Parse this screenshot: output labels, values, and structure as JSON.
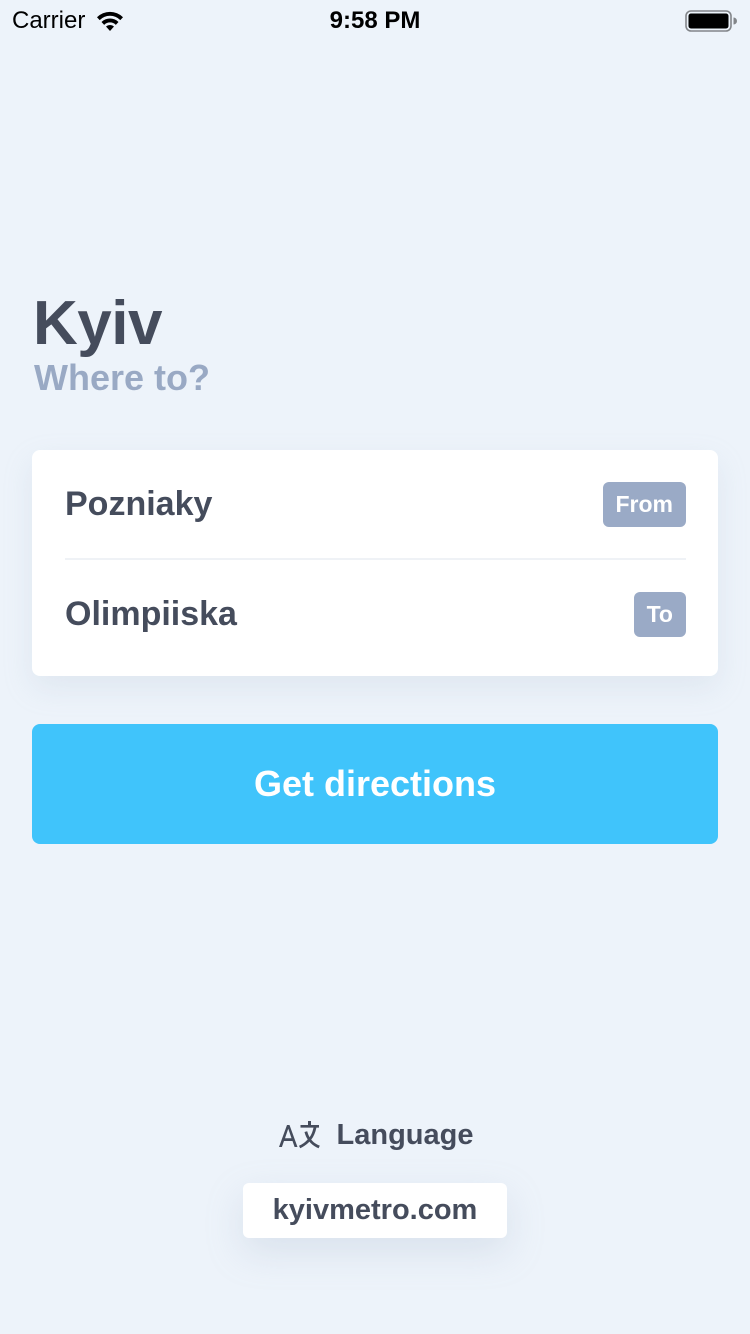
{
  "status_bar": {
    "carrier": "Carrier",
    "time": "9:58 PM",
    "wifi_icon": "wifi-icon",
    "battery_icon": "battery-full-icon"
  },
  "header": {
    "title": "Kyiv",
    "subtitle": "Where to?"
  },
  "route": {
    "from": {
      "station": "Pozniaky",
      "badge": "From"
    },
    "to": {
      "station": "Olimpiiska",
      "badge": "To"
    }
  },
  "actions": {
    "get_directions_label": "Get directions"
  },
  "footer": {
    "language_icon": "translate-icon",
    "language_label": "Language",
    "site_link": "kyivmetro.com"
  },
  "colors": {
    "background": "#edf3fa",
    "text_primary": "#454c5c",
    "text_secondary": "#99a9c4",
    "badge": "#9aaac6",
    "accent": "#40c4fb",
    "card": "#ffffff"
  }
}
